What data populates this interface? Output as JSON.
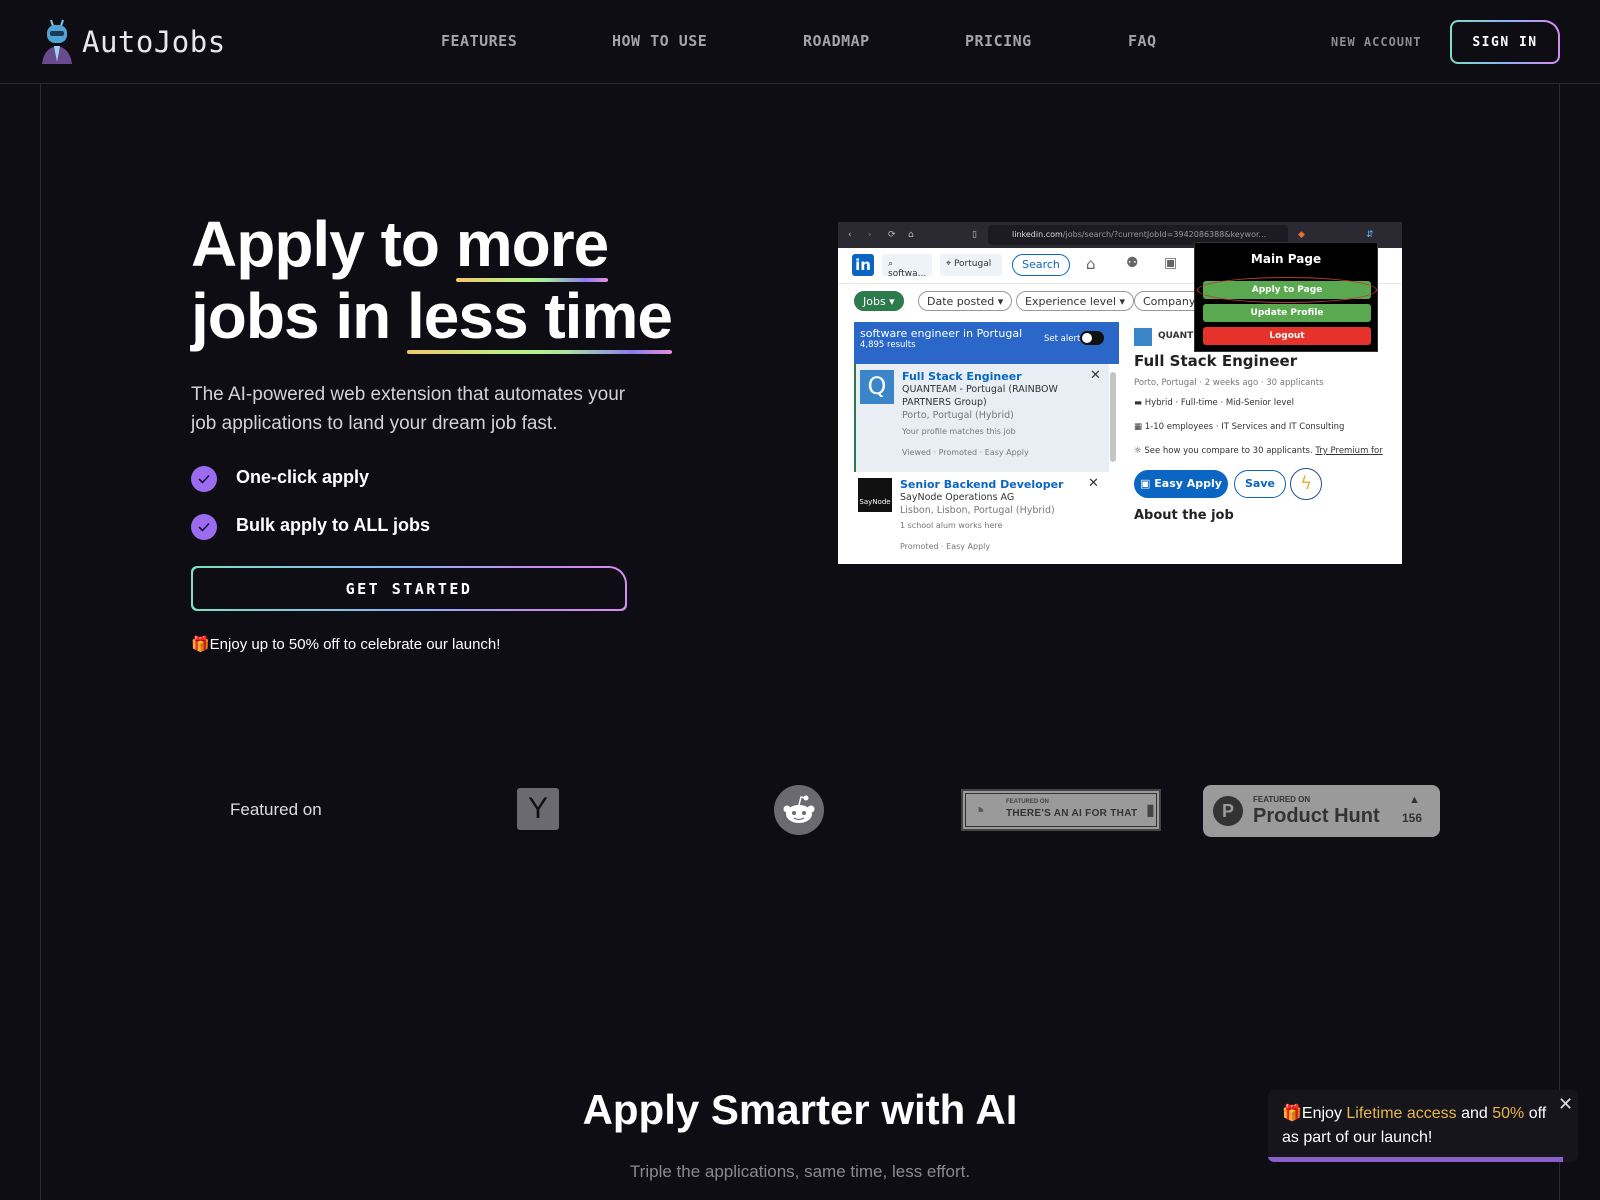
{
  "header": {
    "brand": "AutoJobs",
    "nav": [
      "FEATURES",
      "HOW TO USE",
      "ROADMAP",
      "PRICING",
      "FAQ"
    ],
    "new_account": "NEW ACCOUNT",
    "sign_in": "SIGN IN"
  },
  "hero": {
    "title_part1": "Apply to ",
    "title_highlight1": "more",
    "title_part2": "jobs in ",
    "title_highlight2": "less time",
    "subtitle": "The AI-powered web extension that automates your job applications to land your dream job fast.",
    "features": [
      "One-click apply",
      "Bulk apply to ALL jobs"
    ],
    "cta": "GET STARTED",
    "promo": "🎁Enjoy up to 50% off to celebrate our launch!"
  },
  "screenshot": {
    "url_domain": "linkedin.com",
    "url_path": "/jobs/search/?currentJobId=3942086388&keywor...",
    "search_query": "softwa...",
    "location": "Portugal",
    "search_button": "Search",
    "filters": [
      "Jobs",
      "Date posted",
      "Experience level",
      "Company"
    ],
    "list_header": "software engineer in Portugal",
    "results": "4,895 results",
    "set_alert": "Set alert",
    "jobs": [
      {
        "title": "Full Stack Engineer",
        "company": "QUANTEAM - Portugal (RAINBOW PARTNERS Group)",
        "location": "Porto, Portugal (Hybrid)",
        "insight": "Your profile matches this job",
        "footer": "Viewed · Promoted · Easy Apply"
      },
      {
        "title": "Senior Backend Developer",
        "company": "SayNode Operations AG",
        "location": "Lisbon, Lisbon, Portugal (Hybrid)",
        "insight": "1 school alum works here",
        "footer": "Promoted · Easy Apply",
        "logo_text": "SayNode"
      }
    ],
    "detail": {
      "company": "QUANT",
      "title": "Full Stack Engineer",
      "meta": "Porto, Portugal · 2 weeks ago · 30 applicants",
      "type": "Hybrid · Full-time · Mid-Senior level",
      "size": "1-10 employees · IT Services and IT Consulting",
      "compare": "See how you compare to 30 applicants.",
      "premium": "Try Premium for",
      "easy_apply": "Easy Apply",
      "save": "Save",
      "about": "About the job"
    },
    "extension": {
      "title": "Main Page",
      "apply": "Apply to Page",
      "update": "Update Profile",
      "logout": "Logout"
    }
  },
  "featured": {
    "label": "Featured on",
    "yc": "Y",
    "taaft_small": "FEATURED ON",
    "taaft_big": "THERE'S AN AI FOR THAT",
    "ph_small": "FEATURED ON",
    "ph_big": "Product Hunt",
    "ph_votes": "156"
  },
  "section2": {
    "title": "Apply Smarter with AI",
    "subtitle": "Triple the applications, same time, less effort."
  },
  "toast": {
    "prefix": "🎁Enjoy ",
    "hl1": "Lifetime access",
    "mid": " and ",
    "hl2": "50%",
    "suffix": " off as part of our launch!",
    "close": "✕",
    "progress": 0.95
  }
}
